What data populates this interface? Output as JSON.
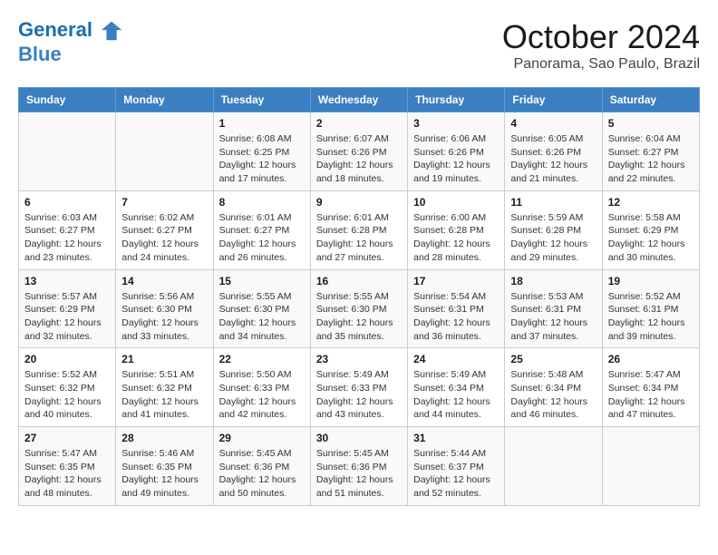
{
  "header": {
    "logo_line1": "General",
    "logo_line2": "Blue",
    "month": "October 2024",
    "location": "Panorama, Sao Paulo, Brazil"
  },
  "weekdays": [
    "Sunday",
    "Monday",
    "Tuesday",
    "Wednesday",
    "Thursday",
    "Friday",
    "Saturday"
  ],
  "weeks": [
    [
      {
        "day": "",
        "sunrise": "",
        "sunset": "",
        "daylight": ""
      },
      {
        "day": "",
        "sunrise": "",
        "sunset": "",
        "daylight": ""
      },
      {
        "day": "1",
        "sunrise": "Sunrise: 6:08 AM",
        "sunset": "Sunset: 6:25 PM",
        "daylight": "Daylight: 12 hours and 17 minutes."
      },
      {
        "day": "2",
        "sunrise": "Sunrise: 6:07 AM",
        "sunset": "Sunset: 6:26 PM",
        "daylight": "Daylight: 12 hours and 18 minutes."
      },
      {
        "day": "3",
        "sunrise": "Sunrise: 6:06 AM",
        "sunset": "Sunset: 6:26 PM",
        "daylight": "Daylight: 12 hours and 19 minutes."
      },
      {
        "day": "4",
        "sunrise": "Sunrise: 6:05 AM",
        "sunset": "Sunset: 6:26 PM",
        "daylight": "Daylight: 12 hours and 21 minutes."
      },
      {
        "day": "5",
        "sunrise": "Sunrise: 6:04 AM",
        "sunset": "Sunset: 6:27 PM",
        "daylight": "Daylight: 12 hours and 22 minutes."
      }
    ],
    [
      {
        "day": "6",
        "sunrise": "Sunrise: 6:03 AM",
        "sunset": "Sunset: 6:27 PM",
        "daylight": "Daylight: 12 hours and 23 minutes."
      },
      {
        "day": "7",
        "sunrise": "Sunrise: 6:02 AM",
        "sunset": "Sunset: 6:27 PM",
        "daylight": "Daylight: 12 hours and 24 minutes."
      },
      {
        "day": "8",
        "sunrise": "Sunrise: 6:01 AM",
        "sunset": "Sunset: 6:27 PM",
        "daylight": "Daylight: 12 hours and 26 minutes."
      },
      {
        "day": "9",
        "sunrise": "Sunrise: 6:01 AM",
        "sunset": "Sunset: 6:28 PM",
        "daylight": "Daylight: 12 hours and 27 minutes."
      },
      {
        "day": "10",
        "sunrise": "Sunrise: 6:00 AM",
        "sunset": "Sunset: 6:28 PM",
        "daylight": "Daylight: 12 hours and 28 minutes."
      },
      {
        "day": "11",
        "sunrise": "Sunrise: 5:59 AM",
        "sunset": "Sunset: 6:28 PM",
        "daylight": "Daylight: 12 hours and 29 minutes."
      },
      {
        "day": "12",
        "sunrise": "Sunrise: 5:58 AM",
        "sunset": "Sunset: 6:29 PM",
        "daylight": "Daylight: 12 hours and 30 minutes."
      }
    ],
    [
      {
        "day": "13",
        "sunrise": "Sunrise: 5:57 AM",
        "sunset": "Sunset: 6:29 PM",
        "daylight": "Daylight: 12 hours and 32 minutes."
      },
      {
        "day": "14",
        "sunrise": "Sunrise: 5:56 AM",
        "sunset": "Sunset: 6:30 PM",
        "daylight": "Daylight: 12 hours and 33 minutes."
      },
      {
        "day": "15",
        "sunrise": "Sunrise: 5:55 AM",
        "sunset": "Sunset: 6:30 PM",
        "daylight": "Daylight: 12 hours and 34 minutes."
      },
      {
        "day": "16",
        "sunrise": "Sunrise: 5:55 AM",
        "sunset": "Sunset: 6:30 PM",
        "daylight": "Daylight: 12 hours and 35 minutes."
      },
      {
        "day": "17",
        "sunrise": "Sunrise: 5:54 AM",
        "sunset": "Sunset: 6:31 PM",
        "daylight": "Daylight: 12 hours and 36 minutes."
      },
      {
        "day": "18",
        "sunrise": "Sunrise: 5:53 AM",
        "sunset": "Sunset: 6:31 PM",
        "daylight": "Daylight: 12 hours and 37 minutes."
      },
      {
        "day": "19",
        "sunrise": "Sunrise: 5:52 AM",
        "sunset": "Sunset: 6:31 PM",
        "daylight": "Daylight: 12 hours and 39 minutes."
      }
    ],
    [
      {
        "day": "20",
        "sunrise": "Sunrise: 5:52 AM",
        "sunset": "Sunset: 6:32 PM",
        "daylight": "Daylight: 12 hours and 40 minutes."
      },
      {
        "day": "21",
        "sunrise": "Sunrise: 5:51 AM",
        "sunset": "Sunset: 6:32 PM",
        "daylight": "Daylight: 12 hours and 41 minutes."
      },
      {
        "day": "22",
        "sunrise": "Sunrise: 5:50 AM",
        "sunset": "Sunset: 6:33 PM",
        "daylight": "Daylight: 12 hours and 42 minutes."
      },
      {
        "day": "23",
        "sunrise": "Sunrise: 5:49 AM",
        "sunset": "Sunset: 6:33 PM",
        "daylight": "Daylight: 12 hours and 43 minutes."
      },
      {
        "day": "24",
        "sunrise": "Sunrise: 5:49 AM",
        "sunset": "Sunset: 6:34 PM",
        "daylight": "Daylight: 12 hours and 44 minutes."
      },
      {
        "day": "25",
        "sunrise": "Sunrise: 5:48 AM",
        "sunset": "Sunset: 6:34 PM",
        "daylight": "Daylight: 12 hours and 46 minutes."
      },
      {
        "day": "26",
        "sunrise": "Sunrise: 5:47 AM",
        "sunset": "Sunset: 6:34 PM",
        "daylight": "Daylight: 12 hours and 47 minutes."
      }
    ],
    [
      {
        "day": "27",
        "sunrise": "Sunrise: 5:47 AM",
        "sunset": "Sunset: 6:35 PM",
        "daylight": "Daylight: 12 hours and 48 minutes."
      },
      {
        "day": "28",
        "sunrise": "Sunrise: 5:46 AM",
        "sunset": "Sunset: 6:35 PM",
        "daylight": "Daylight: 12 hours and 49 minutes."
      },
      {
        "day": "29",
        "sunrise": "Sunrise: 5:45 AM",
        "sunset": "Sunset: 6:36 PM",
        "daylight": "Daylight: 12 hours and 50 minutes."
      },
      {
        "day": "30",
        "sunrise": "Sunrise: 5:45 AM",
        "sunset": "Sunset: 6:36 PM",
        "daylight": "Daylight: 12 hours and 51 minutes."
      },
      {
        "day": "31",
        "sunrise": "Sunrise: 5:44 AM",
        "sunset": "Sunset: 6:37 PM",
        "daylight": "Daylight: 12 hours and 52 minutes."
      },
      {
        "day": "",
        "sunrise": "",
        "sunset": "",
        "daylight": ""
      },
      {
        "day": "",
        "sunrise": "",
        "sunset": "",
        "daylight": ""
      }
    ]
  ]
}
